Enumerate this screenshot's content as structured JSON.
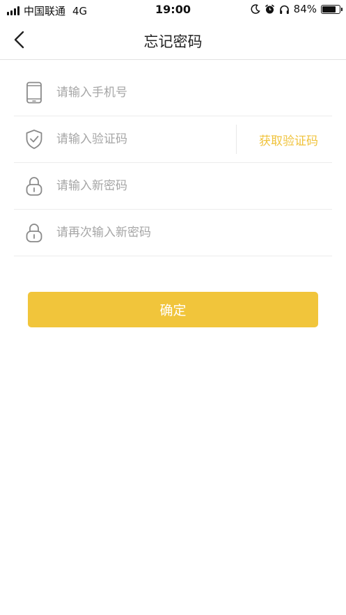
{
  "status_bar": {
    "carrier": "中国联通",
    "network": "4G",
    "time": "19:00",
    "battery_percent": "84%",
    "battery_level": 0.84
  },
  "header": {
    "title": "忘记密码"
  },
  "form": {
    "phone_placeholder": "请输入手机号",
    "code_placeholder": "请输入验证码",
    "get_code_label": "获取验证码",
    "new_password_placeholder": "请输入新密码",
    "confirm_password_placeholder": "请再次输入新密码"
  },
  "confirm_button_label": "确定",
  "colors": {
    "accent": "#f1c53b",
    "link": "#f0c33c",
    "placeholder": "#a6a6a6",
    "icon": "#8a8a8a"
  },
  "icons": {
    "phone": "phone-icon",
    "code": "shield-check-icon",
    "password": "lock-icon",
    "back": "chevron-left-icon"
  }
}
